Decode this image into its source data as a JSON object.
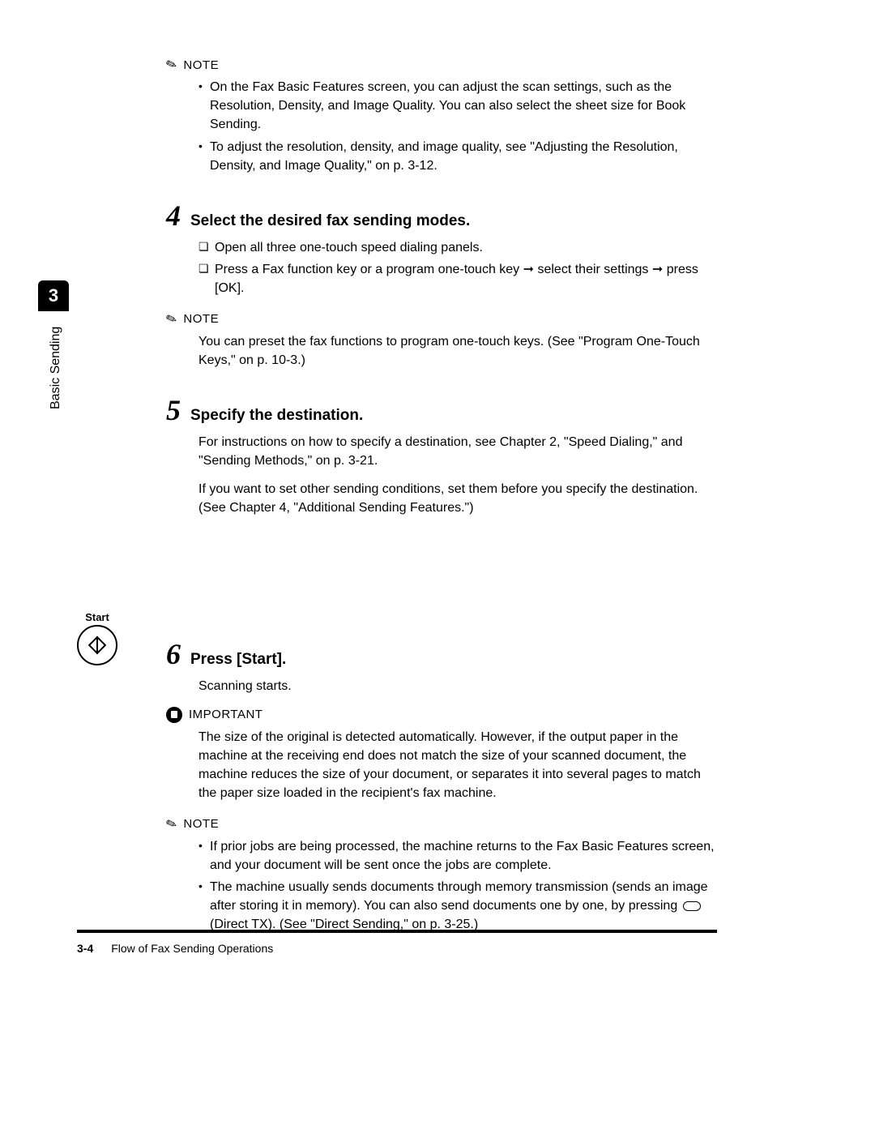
{
  "sideTab": "3",
  "sideLabel": "Basic Sending",
  "note1": {
    "label": "NOTE",
    "items": [
      "On the Fax Basic Features screen, you can adjust the scan settings, such as the Resolution, Density, and Image Quality. You can also select the sheet size for Book Sending.",
      "To adjust the resolution, density, and image quality, see \"Adjusting the Resolution, Density, and Image Quality,\" on p. 3-12."
    ]
  },
  "step4": {
    "number": "4",
    "title": "Select the desired fax sending modes.",
    "checks": [
      "Open all three one-touch speed dialing panels.",
      "Press a Fax function key or a program one-touch key ➞ select their settings ➞ press [OK]."
    ]
  },
  "note2": {
    "label": "NOTE",
    "text": "You can preset the fax functions to program one-touch keys. (See \"Program One-Touch Keys,\" on p. 10-3.)"
  },
  "step5": {
    "number": "5",
    "title": "Specify the destination.",
    "paras": [
      "For instructions on how to specify a destination, see Chapter 2, \"Speed Dialing,\" and \"Sending Methods,\" on p. 3-21.",
      "If you want to set other sending conditions, set them before you specify the destination. (See Chapter 4, \"Additional Sending Features.\")"
    ]
  },
  "startButton": "Start",
  "step6": {
    "number": "6",
    "title": "Press [Start].",
    "para": "Scanning starts."
  },
  "important": {
    "label": "IMPORTANT",
    "text": "The size of the original is detected automatically. However, if the output paper in the machine at the receiving end does not match the size of your scanned document, the machine reduces the size of your document, or separates it into several pages to match the paper size loaded in the recipient's fax machine."
  },
  "note3": {
    "label": "NOTE",
    "items": [
      "If prior jobs are being processed, the machine returns to the Fax Basic Features screen, and your document will be sent once the jobs are complete."
    ],
    "lastItemPrefix": "The machine usually sends documents through memory transmission (sends an image after storing it in memory). You can also send documents one by one, by pressing ",
    "lastItemSuffix": " (Direct TX). (See \"Direct Sending,\" on p. 3-25.)"
  },
  "footer": {
    "pageNum": "3-4",
    "title": "Flow of Fax Sending Operations"
  }
}
